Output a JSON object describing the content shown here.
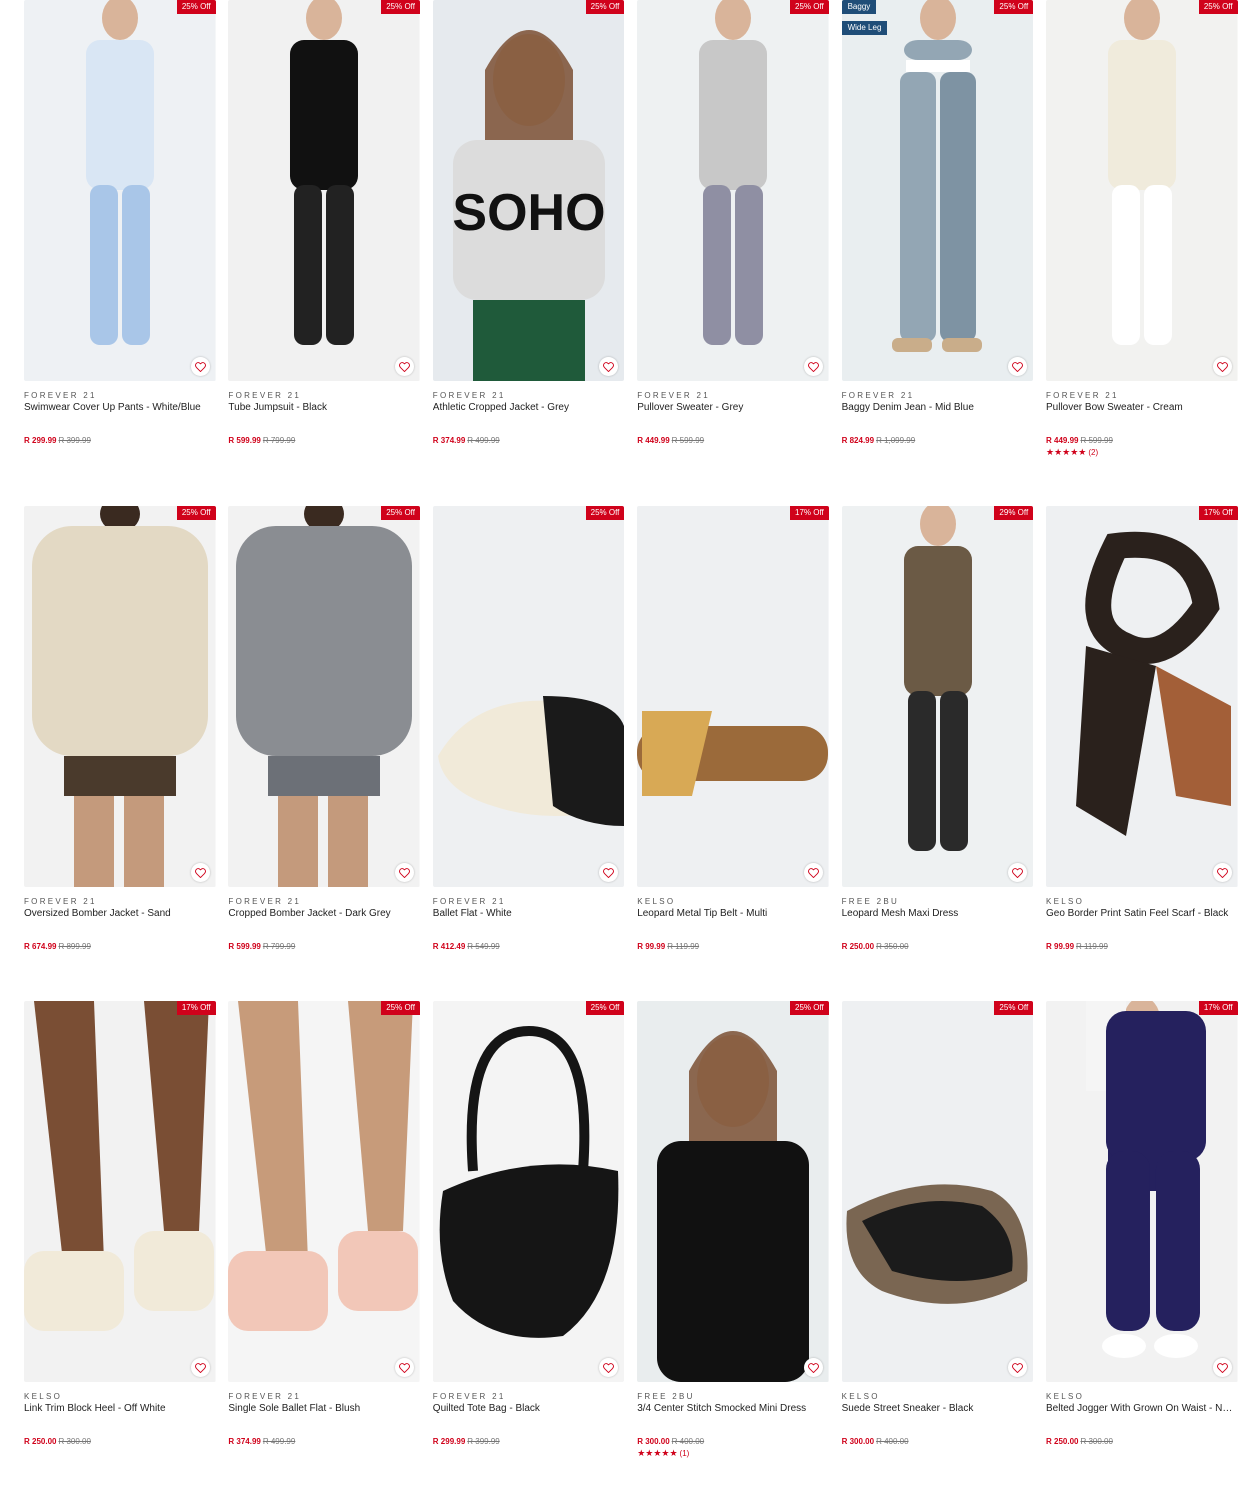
{
  "products": [
    {
      "brand": "FOREVER 21",
      "name": "Swimwear Cover Up Pants - White/Blue",
      "price": "R 299.99",
      "was": "R 399.99",
      "badge": "25% Off",
      "bg": "#eef1f4",
      "tone": "#d9e6f4",
      "accent": "#a9c6e8",
      "kind": "person-light",
      "rating": null
    },
    {
      "brand": "FOREVER 21",
      "name": "Tube Jumpsuit - Black",
      "price": "R 599.99",
      "was": "R 799.99",
      "badge": "25% Off",
      "bg": "#f1f1f1",
      "tone": "#111111",
      "accent": "#222222",
      "kind": "person-dark",
      "rating": null
    },
    {
      "brand": "FOREVER 21",
      "name": "Athletic Cropped Jacket - Grey",
      "price": "R 374.99",
      "was": "R 499.99",
      "badge": "25% Off",
      "bg": "#e6eaee",
      "tone": "#dcdcdc",
      "accent": "#1f5a3a",
      "kind": "portrait",
      "rating": null
    },
    {
      "brand": "FOREVER 21",
      "name": "Pullover Sweater - Grey",
      "price": "R 449.99",
      "was": "R 599.99",
      "badge": "25% Off",
      "bg": "#eef1f2",
      "tone": "#c8c8c8",
      "accent": "#8f8fa3",
      "kind": "person-light",
      "rating": null
    },
    {
      "brand": "FOREVER 21",
      "name": "Baggy Denim Jean - Mid Blue",
      "price": "R 824.99",
      "was": "R 1,099.99",
      "badge": "25% Off",
      "bg": "#e9eef0",
      "tone": "#93a6b4",
      "accent": "#7e93a3",
      "kind": "jeans",
      "rating": null,
      "tags": [
        "Baggy",
        "Wide Leg"
      ]
    },
    {
      "brand": "FOREVER 21",
      "name": "Pullover Bow Sweater - Cream",
      "price": "R 449.99",
      "was": "R 599.99",
      "badge": "25% Off",
      "bg": "#f2f2f0",
      "tone": "#f0ebdc",
      "accent": "#ffffff",
      "kind": "person-light",
      "rating": {
        "stars": "★★★★★",
        "count": "(2)"
      }
    },
    {
      "brand": "FOREVER 21",
      "name": "Oversized Bomber Jacket - Sand",
      "price": "R 674.99",
      "was": "R 899.99",
      "badge": "25% Off",
      "bg": "#f2f2f2",
      "tone": "#e3d9c4",
      "accent": "#4a3a2c",
      "kind": "jacket",
      "rating": null
    },
    {
      "brand": "FOREVER 21",
      "name": "Cropped Bomber Jacket - Dark Grey",
      "price": "R 599.99",
      "was": "R 799.99",
      "badge": "25% Off",
      "bg": "#f2f2f2",
      "tone": "#8a8d92",
      "accent": "#6c7077",
      "kind": "jacket",
      "rating": null
    },
    {
      "brand": "FOREVER 21",
      "name": "Ballet Flat - White",
      "price": "R 412.49",
      "was": "R 549.99",
      "badge": "25% Off",
      "bg": "#eef0f2",
      "tone": "#f1ead9",
      "accent": "#1a1a1a",
      "kind": "shoe",
      "rating": null
    },
    {
      "brand": "KELSO",
      "name": "Leopard Metal Tip Belt - Multi",
      "price": "R 99.99",
      "was": "R 119.99",
      "badge": "17% Off",
      "bg": "#eef0f2",
      "tone": "#9b6a3a",
      "accent": "#d8a955",
      "kind": "belt",
      "rating": null
    },
    {
      "brand": "FREE 2BU",
      "name": "Leopard Mesh Maxi Dress",
      "price": "R 250.00",
      "was": "R 350.00",
      "badge": "29% Off",
      "bg": "#eef1f2",
      "tone": "#6b5a45",
      "accent": "#2a2a2a",
      "kind": "person-dark",
      "rating": null
    },
    {
      "brand": "KELSO",
      "name": "Geo Border Print Satin Feel Scarf - Black",
      "price": "R 99.99",
      "was": "R 119.99",
      "badge": "17% Off",
      "bg": "#eef0f2",
      "tone": "#2a211c",
      "accent": "#a35f38",
      "kind": "scarf",
      "rating": null
    },
    {
      "brand": "KELSO",
      "name": "Link Trim Block Heel - Off White",
      "price": "R 250.00",
      "was": "R 300.00",
      "badge": "17% Off",
      "bg": "#f2f2f2",
      "tone": "#7a4e34",
      "accent": "#f1ead9",
      "kind": "legs",
      "rating": null
    },
    {
      "brand": "FOREVER 21",
      "name": "Single Sole Ballet Flat - Blush",
      "price": "R 374.99",
      "was": "R 499.99",
      "badge": "25% Off",
      "bg": "#f5f5f5",
      "tone": "#c79b7a",
      "accent": "#f2c7b8",
      "kind": "legs",
      "rating": null
    },
    {
      "brand": "FOREVER 21",
      "name": "Quilted Tote Bag - Black",
      "price": "R 299.99",
      "was": "R 399.99",
      "badge": "25% Off",
      "bg": "#f4f4f4",
      "tone": "#151515",
      "accent": "#2a2a2a",
      "kind": "bag",
      "rating": null
    },
    {
      "brand": "FREE 2BU",
      "name": "3/4 Center Stitch Smocked Mini Dress",
      "price": "R 300.00",
      "was": "R 400.00",
      "badge": "25% Off",
      "bg": "#e9edee",
      "tone": "#111111",
      "accent": "#2a2a2a",
      "kind": "portrait-dark",
      "rating": {
        "stars": "★★★★★",
        "count": "(1)"
      }
    },
    {
      "brand": "KELSO",
      "name": "Suede Street Sneaker - Black",
      "price": "R 300.00",
      "was": "R 400.00",
      "badge": "25% Off",
      "bg": "#eef0f2",
      "tone": "#1b1b1b",
      "accent": "#7a6652",
      "kind": "sneaker",
      "rating": null
    },
    {
      "brand": "KELSO",
      "name": "Belted Jogger With Grown On Waist - Navy",
      "price": "R 250.00",
      "was": "R 300.00",
      "badge": "17% Off",
      "bg": "#f2f2f2",
      "tone": "#25215e",
      "accent": "#ffffff",
      "kind": "jogger",
      "rating": null
    }
  ],
  "icons": {
    "wishlist": "heart-icon",
    "rating": "star-icon"
  },
  "colors": {
    "sale": "#d0021b",
    "tag": "#1f4d78"
  }
}
